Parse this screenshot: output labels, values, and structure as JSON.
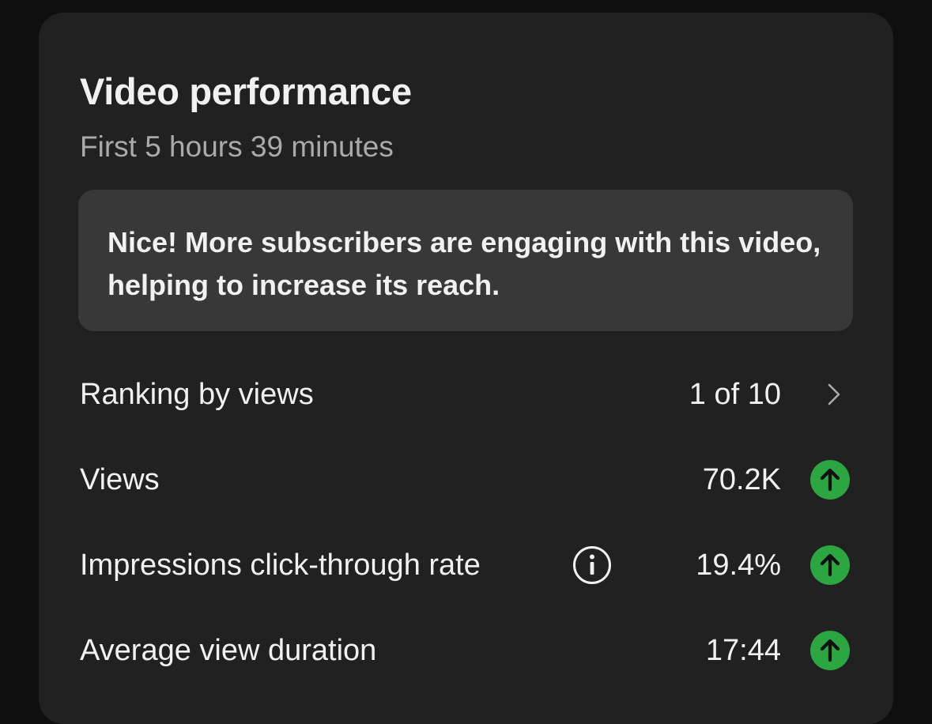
{
  "card": {
    "title": "Video performance",
    "subtitle": "First 5 hours 39 minutes",
    "insight": "Nice! More subscribers are engaging with this video, helping to increase its reach."
  },
  "metrics": {
    "ranking": {
      "label": "Ranking by views",
      "value": "1 of 10",
      "icon": "chevron-right-icon"
    },
    "views": {
      "label": "Views",
      "value": "70.2K",
      "trend": "up",
      "icon": "arrow-up-circle-icon"
    },
    "ctr": {
      "label": "Impressions click-through rate",
      "value": "19.4%",
      "trend": "up",
      "icon": "arrow-up-circle-icon",
      "info_icon": "info-icon"
    },
    "avg_duration": {
      "label": "Average view duration",
      "value": "17:44",
      "trend": "up",
      "icon": "arrow-up-circle-icon"
    }
  },
  "colors": {
    "background": "#0f0f0f",
    "card": "#212121",
    "insight_box": "#383838",
    "trend_up": "#2ba640",
    "secondary_text": "#aaaaaa"
  }
}
